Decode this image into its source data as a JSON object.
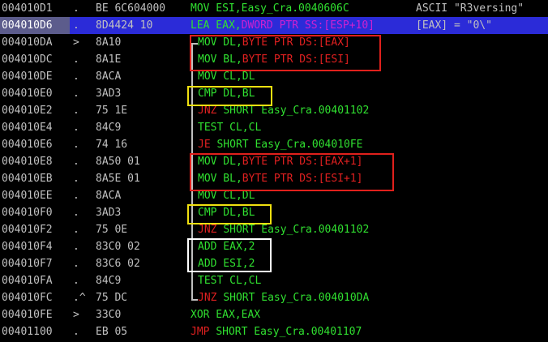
{
  "rows": [
    {
      "addr": "004010D1",
      "mark": ".",
      "hex": "BE 6C604000",
      "dis": [
        {
          "t": "MOV ESI,Easy_Cra.0040606C",
          "c": "g"
        }
      ],
      "comment": "ASCII \"R3versing\""
    },
    {
      "addr": "004010D6",
      "mark": ".",
      "hex": "8D4424 10",
      "dis": [
        {
          "t": "LEA EAX,",
          "c": "g"
        },
        {
          "t": "DWORD PTR SS:[ESP+10]",
          "c": "m"
        }
      ],
      "comment": "[EAX] = \"0\\\""
    },
    {
      "addr": "004010DA",
      "mark": ">",
      "hex": "8A10",
      "dis": [
        {
          "t": "MOV DL,",
          "c": "g"
        },
        {
          "t": "BYTE PTR DS:[EAX]",
          "c": "r"
        }
      ],
      "comment": ""
    },
    {
      "addr": "004010DC",
      "mark": ".",
      "hex": "8A1E",
      "dis": [
        {
          "t": "MOV BL,",
          "c": "g"
        },
        {
          "t": "BYTE PTR DS:[ESI]",
          "c": "r"
        }
      ],
      "comment": ""
    },
    {
      "addr": "004010DE",
      "mark": ".",
      "hex": "8ACA",
      "dis": [
        {
          "t": "MOV CL,DL",
          "c": "g"
        }
      ],
      "comment": ""
    },
    {
      "addr": "004010E0",
      "mark": ".",
      "hex": "3AD3",
      "dis": [
        {
          "t": "CMP DL,BL",
          "c": "g"
        }
      ],
      "comment": ""
    },
    {
      "addr": "004010E2",
      "mark": ".",
      "hex": "75 1E",
      "dis": [
        {
          "t": "JNZ ",
          "c": "r"
        },
        {
          "t": "SHORT Easy_Cra.00401102",
          "c": "g"
        }
      ],
      "comment": ""
    },
    {
      "addr": "004010E4",
      "mark": ".",
      "hex": "84C9",
      "dis": [
        {
          "t": "TEST CL,CL",
          "c": "g"
        }
      ],
      "comment": ""
    },
    {
      "addr": "004010E6",
      "mark": ".",
      "hex": "74 16",
      "dis": [
        {
          "t": "JE ",
          "c": "r"
        },
        {
          "t": "SHORT Easy_Cra.004010FE",
          "c": "g"
        }
      ],
      "comment": ""
    },
    {
      "addr": "004010E8",
      "mark": ".",
      "hex": "8A50 01",
      "dis": [
        {
          "t": "MOV DL,",
          "c": "g"
        },
        {
          "t": "BYTE PTR DS:[EAX+1]",
          "c": "r"
        }
      ],
      "comment": ""
    },
    {
      "addr": "004010EB",
      "mark": ".",
      "hex": "8A5E 01",
      "dis": [
        {
          "t": "MOV BL,",
          "c": "g"
        },
        {
          "t": "BYTE PTR DS:[ESI+1]",
          "c": "r"
        }
      ],
      "comment": ""
    },
    {
      "addr": "004010EE",
      "mark": ".",
      "hex": "8ACA",
      "dis": [
        {
          "t": "MOV CL,DL",
          "c": "g"
        }
      ],
      "comment": ""
    },
    {
      "addr": "004010F0",
      "mark": ".",
      "hex": "3AD3",
      "dis": [
        {
          "t": "CMP DL,BL",
          "c": "g"
        }
      ],
      "comment": ""
    },
    {
      "addr": "004010F2",
      "mark": ".",
      "hex": "75 0E",
      "dis": [
        {
          "t": "JNZ ",
          "c": "r"
        },
        {
          "t": "SHORT Easy_Cra.00401102",
          "c": "g"
        }
      ],
      "comment": ""
    },
    {
      "addr": "004010F4",
      "mark": ".",
      "hex": "83C0 02",
      "dis": [
        {
          "t": "ADD EAX,2",
          "c": "g"
        }
      ],
      "comment": ""
    },
    {
      "addr": "004010F7",
      "mark": ".",
      "hex": "83C6 02",
      "dis": [
        {
          "t": "ADD ESI,2",
          "c": "g"
        }
      ],
      "comment": ""
    },
    {
      "addr": "004010FA",
      "mark": ".",
      "hex": "84C9",
      "dis": [
        {
          "t": "TEST CL,CL",
          "c": "g"
        }
      ],
      "comment": ""
    },
    {
      "addr": "004010FC",
      "mark": ".^",
      "hex": "75 DC",
      "dis": [
        {
          "t": "JNZ ",
          "c": "r"
        },
        {
          "t": "SHORT Easy_Cra.004010DA",
          "c": "g"
        }
      ],
      "comment": ""
    },
    {
      "addr": "004010FE",
      "mark": ">",
      "hex": "33C0",
      "dis": [
        {
          "t": "XOR EAX,EAX",
          "c": "g"
        }
      ],
      "comment": ""
    },
    {
      "addr": "00401100",
      "mark": ".",
      "hex": "EB 05",
      "dis": [
        {
          "t": "JMP ",
          "c": "r"
        },
        {
          "t": "SHORT Easy_Cra.00401107",
          "c": "g"
        }
      ],
      "comment": ""
    }
  ],
  "selected_row": 1,
  "colors": {
    "background": "#000000",
    "selection": "#2b2bd8",
    "instruction": "#30e030",
    "memory_operand": "#d020d0",
    "jump": "#e02020",
    "highlight_red": "#e0201c",
    "highlight_yellow": "#f0e010",
    "highlight_white": "#ffffff"
  }
}
